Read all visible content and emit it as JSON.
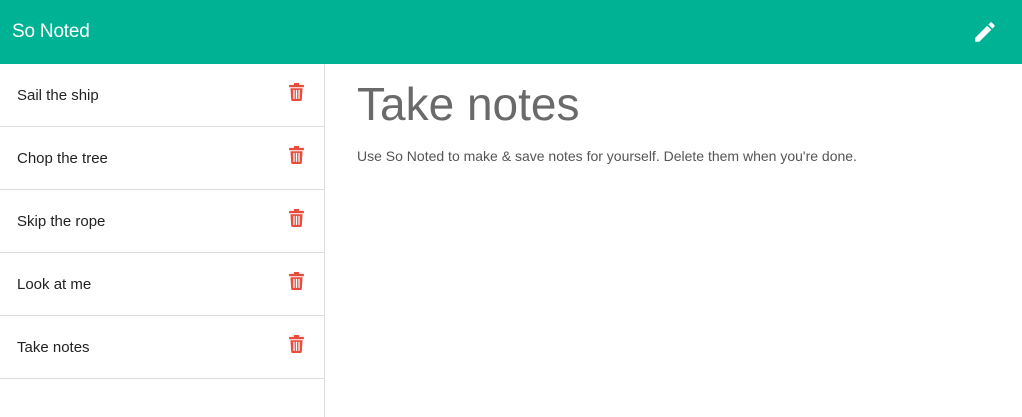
{
  "navbar": {
    "brand": "So Noted",
    "new_note_icon": "pencil-icon",
    "bg_color": "#00b294"
  },
  "sidebar": {
    "notes": [
      {
        "title": "Sail the ship"
      },
      {
        "title": "Chop the tree"
      },
      {
        "title": "Skip the rope"
      },
      {
        "title": "Look at me"
      },
      {
        "title": "Take notes"
      }
    ],
    "delete_icon": "trash-icon",
    "delete_color": "#e74c3c"
  },
  "main": {
    "title": "Take notes",
    "body": "Use So Noted to make & save notes for yourself. Delete them when you're done."
  }
}
